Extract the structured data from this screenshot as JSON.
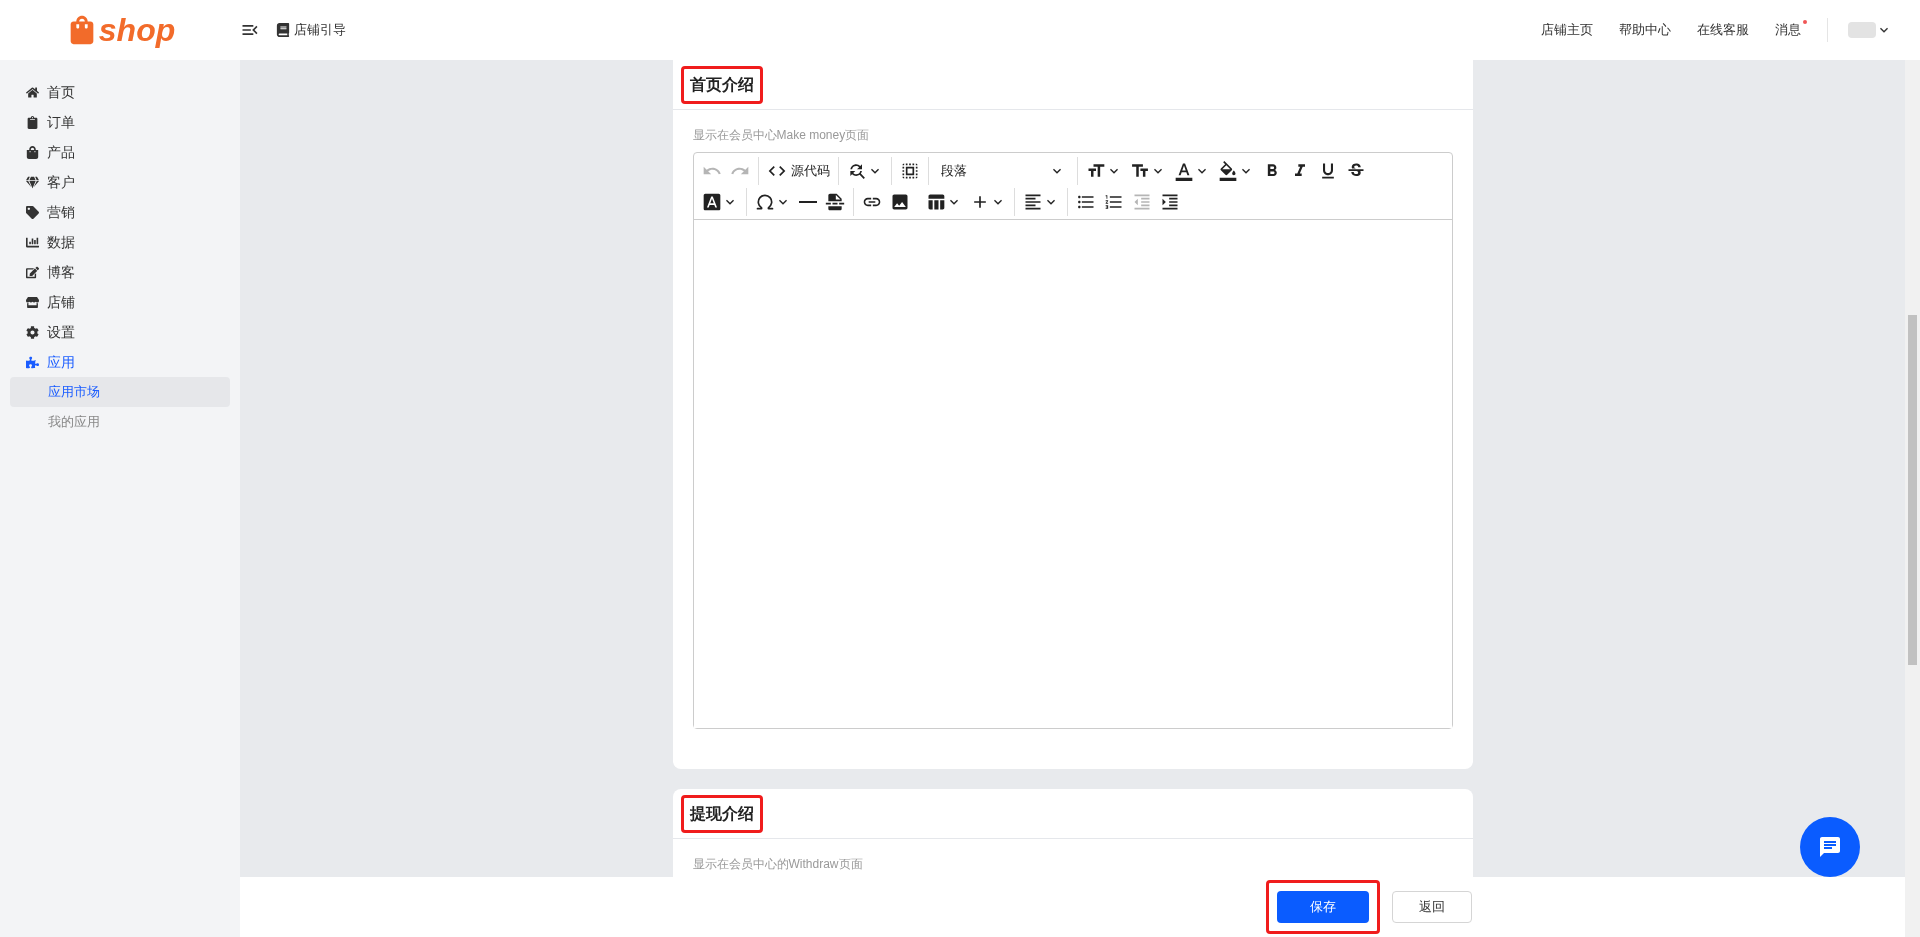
{
  "header": {
    "logo_text": "shop",
    "guide_link": "店铺引导",
    "links": [
      {
        "label": "店铺主页",
        "unread": false
      },
      {
        "label": "帮助中心",
        "unread": false
      },
      {
        "label": "在线客服",
        "unread": false
      },
      {
        "label": "消息",
        "unread": true
      }
    ]
  },
  "sidebar": {
    "items": [
      {
        "label": "首页",
        "selected": false
      },
      {
        "label": "订单",
        "selected": false
      },
      {
        "label": "产品",
        "selected": false
      },
      {
        "label": "客户",
        "selected": false
      },
      {
        "label": "营销",
        "selected": false
      },
      {
        "label": "数据",
        "selected": false
      },
      {
        "label": "博客",
        "selected": false
      },
      {
        "label": "店铺",
        "selected": false
      },
      {
        "label": "设置",
        "selected": false
      },
      {
        "label": "应用",
        "selected": true,
        "expanded": true,
        "children": [
          {
            "label": "应用市场",
            "selected": true
          },
          {
            "label": "我的应用",
            "selected": false
          }
        ]
      }
    ]
  },
  "sections": [
    {
      "title": "首页介绍",
      "highlighted": true,
      "hint": "显示在会员中心Make money页面",
      "editor": {
        "undo_disabled": true,
        "redo_disabled": true,
        "source_label": "源代码",
        "block_format": "段落",
        "outdent_disabled": true
      }
    },
    {
      "title": "提现介绍",
      "highlighted": true,
      "hint": "显示在会员中心的Withdraw页面"
    }
  ],
  "footer": {
    "save_label": "保存",
    "save_highlighted": true,
    "back_label": "返回"
  }
}
